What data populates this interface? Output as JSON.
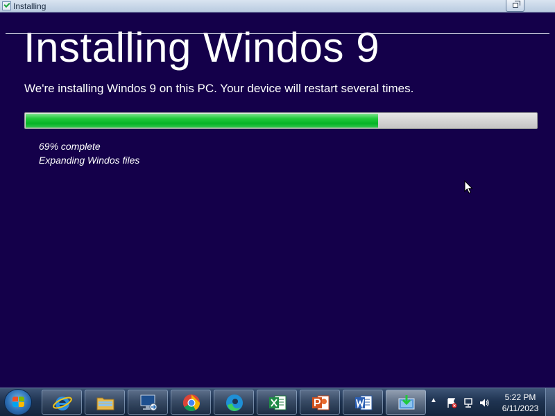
{
  "window": {
    "title": "Installing",
    "app_icon": "installer-check-icon",
    "restore_icon": "restore-window-icon"
  },
  "main": {
    "headline": "Installing Windos 9",
    "subtitle": "We're installing Windos 9 on this PC. Your device will restart several times.",
    "progress_fraction": 0.69,
    "percent_text": "69% complete",
    "status_text": "Expanding Windos files"
  },
  "taskbar": {
    "start_icon": "windows-start-orb-icon",
    "apps": [
      {
        "name": "internet-explorer-icon"
      },
      {
        "name": "file-explorer-icon"
      },
      {
        "name": "remote-desktop-icon"
      },
      {
        "name": "chrome-icon"
      },
      {
        "name": "edge-icon"
      },
      {
        "name": "excel-icon"
      },
      {
        "name": "powerpoint-icon"
      },
      {
        "name": "word-icon"
      },
      {
        "name": "installer-icon"
      }
    ],
    "tray": {
      "icons": [
        "show-hidden-icons-arrow-icon",
        "action-center-flag-icon",
        "network-icon",
        "volume-icon"
      ],
      "time": "5:22 PM",
      "date": "6/11/2023"
    }
  },
  "colors": {
    "background": "#14004a",
    "progress_fill": "#06b426",
    "progress_track": "#d4d4d4",
    "text": "#ffffff"
  }
}
